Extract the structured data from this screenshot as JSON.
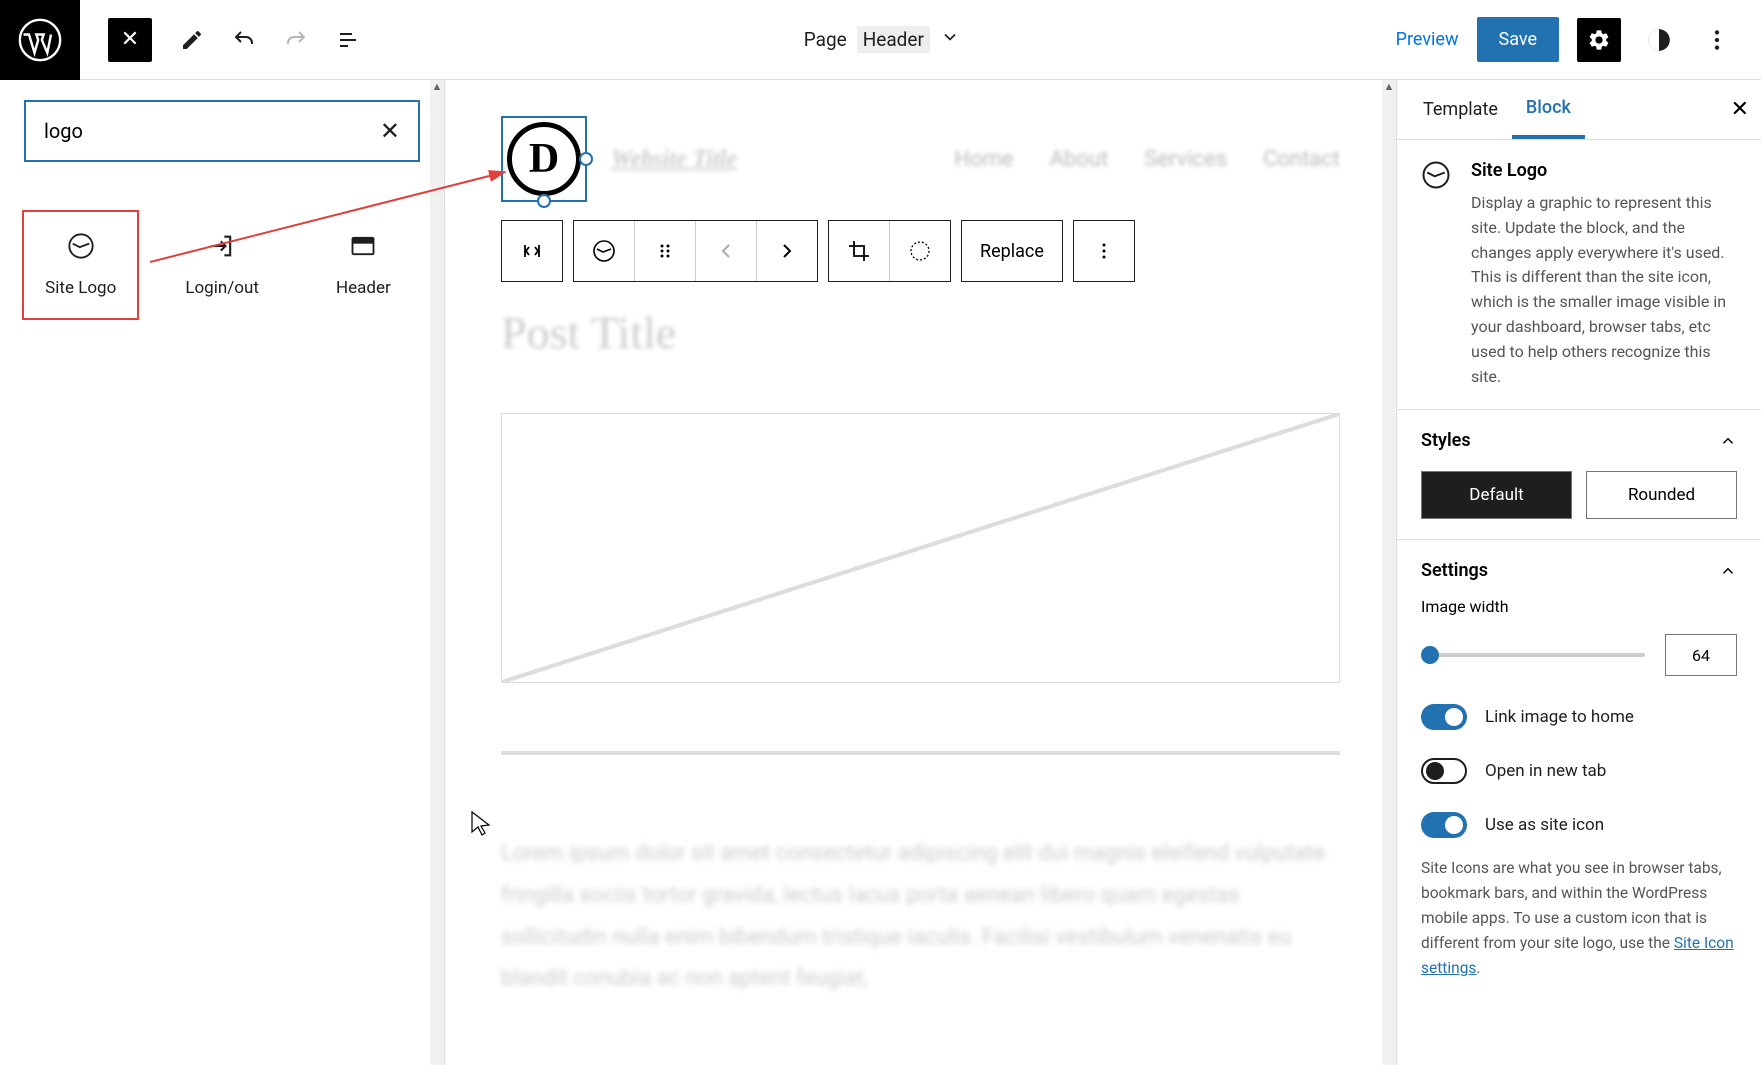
{
  "topbar": {
    "page_label": "Page",
    "template_part": "Header",
    "preview": "Preview",
    "save": "Save"
  },
  "inserter": {
    "search_value": "logo",
    "blocks": [
      {
        "label": "Site Logo"
      },
      {
        "label": "Login/out"
      },
      {
        "label": "Header"
      }
    ]
  },
  "canvas": {
    "site_title": "Website Title",
    "nav": [
      "Home",
      "About",
      "Services",
      "Contact"
    ],
    "toolbar": {
      "replace": "Replace"
    },
    "post_title": "Post Title",
    "lorem": "Lorem ipsum dolor sit amet consectetur adipiscing elit dui magnis eleifend vulputate fringilla sociis tortor gravida, lectus lacus porta aenean libero quam egestas sollicitudin nulla enim bibendum tristique iaculis. Facilisi vestibulum venenatis eu blandit conubia ac non aptent feugiat,"
  },
  "sidebar": {
    "tabs": {
      "template": "Template",
      "block": "Block"
    },
    "block_name": "Site Logo",
    "block_desc": "Display a graphic to represent this site. Update the block, and the changes apply everywhere it's used. This is different than the site icon, which is the smaller image visible in your dashboard, browser tabs, etc used to help others recognize this site.",
    "styles": {
      "title": "Styles",
      "default": "Default",
      "rounded": "Rounded"
    },
    "settings": {
      "title": "Settings",
      "image_width_label": "Image width",
      "image_width_value": "64",
      "link_home": "Link image to home",
      "new_tab": "Open in new tab",
      "use_icon": "Use as site icon",
      "help": "Site Icons are what you see in browser tabs, bookmark bars, and within the WordPress mobile apps. To use a custom icon that is different from your site logo, use the ",
      "help_link": "Site Icon settings",
      "help_end": "."
    }
  }
}
